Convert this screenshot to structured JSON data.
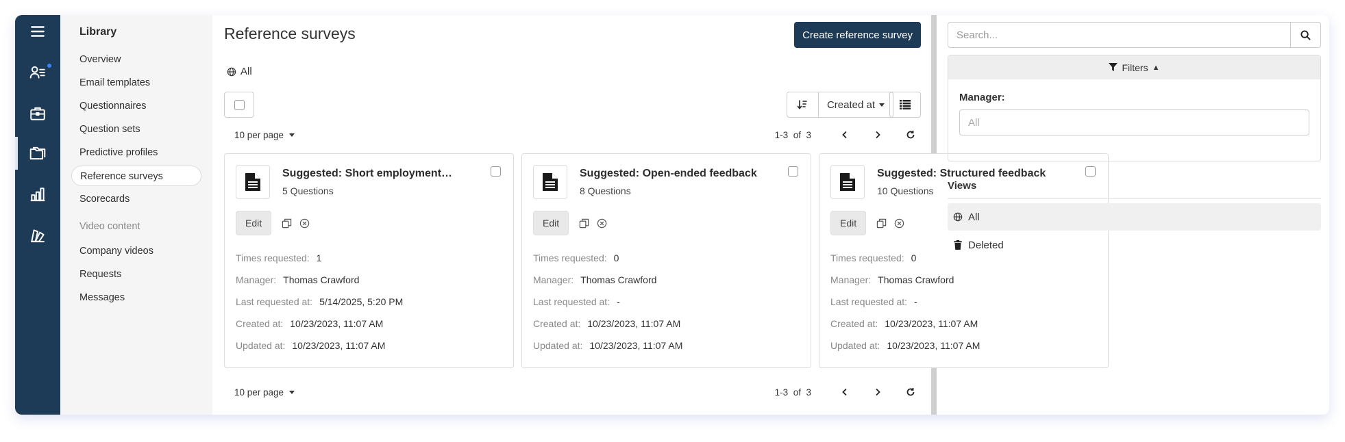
{
  "subnav": {
    "title": "Library",
    "items": [
      {
        "label": "Overview"
      },
      {
        "label": "Email templates"
      },
      {
        "label": "Questionnaires"
      },
      {
        "label": "Question sets"
      },
      {
        "label": "Predictive profiles"
      },
      {
        "label": "Reference surveys"
      },
      {
        "label": "Scorecards"
      }
    ],
    "section_label": "Video content",
    "video_items": [
      {
        "label": "Company videos"
      },
      {
        "label": "Requests"
      },
      {
        "label": "Messages"
      }
    ]
  },
  "header": {
    "title": "Reference surveys",
    "create_label": "Create reference survey",
    "current_view": "All"
  },
  "toolbar": {
    "sort_field": "Created at"
  },
  "pagination": {
    "per_page_label": "10 per page",
    "range": "1-3",
    "of_label": "of",
    "total": "3"
  },
  "cards": [
    {
      "title": "Suggested: Short employment…",
      "questions": "5 Questions",
      "edit_label": "Edit",
      "times_requested_label": "Times requested:",
      "times_requested": "1",
      "manager_label": "Manager:",
      "manager": "Thomas Crawford",
      "last_requested_label": "Last requested at:",
      "last_requested": "5/14/2025, 5:20 PM",
      "created_label": "Created at:",
      "created": "10/23/2023, 11:07 AM",
      "updated_label": "Updated at:",
      "updated": "10/23/2023, 11:07 AM"
    },
    {
      "title": "Suggested: Open-ended feedback",
      "questions": "8 Questions",
      "edit_label": "Edit",
      "times_requested_label": "Times requested:",
      "times_requested": "0",
      "manager_label": "Manager:",
      "manager": "Thomas Crawford",
      "last_requested_label": "Last requested at:",
      "last_requested": "-",
      "created_label": "Created at:",
      "created": "10/23/2023, 11:07 AM",
      "updated_label": "Updated at:",
      "updated": "10/23/2023, 11:07 AM"
    },
    {
      "title": "Suggested: Structured feedback",
      "questions": "10 Questions",
      "edit_label": "Edit",
      "times_requested_label": "Times requested:",
      "times_requested": "0",
      "manager_label": "Manager:",
      "manager": "Thomas Crawford",
      "last_requested_label": "Last requested at:",
      "last_requested": "-",
      "created_label": "Created at:",
      "created": "10/23/2023, 11:07 AM",
      "updated_label": "Updated at:",
      "updated": "10/23/2023, 11:07 AM"
    }
  ],
  "rpanel": {
    "search_placeholder": "Search...",
    "filters_label": "Filters",
    "manager_label": "Manager:",
    "manager_placeholder": "All",
    "views_title": "Views",
    "views": [
      {
        "label": "All"
      },
      {
        "label": "Deleted"
      }
    ]
  },
  "icons": {
    "rail": [
      "menu-icon",
      "candidates-icon",
      "jobs-icon",
      "library-icon",
      "reports-icon",
      "settings-icon"
    ],
    "card": "document-icon",
    "card_actions": [
      "duplicate-icon",
      "delete-icon"
    ]
  },
  "colors": {
    "rail_bg": "#1d3a57",
    "primary_button": "#1d3a57",
    "notification_dot": "#3b82f6"
  }
}
